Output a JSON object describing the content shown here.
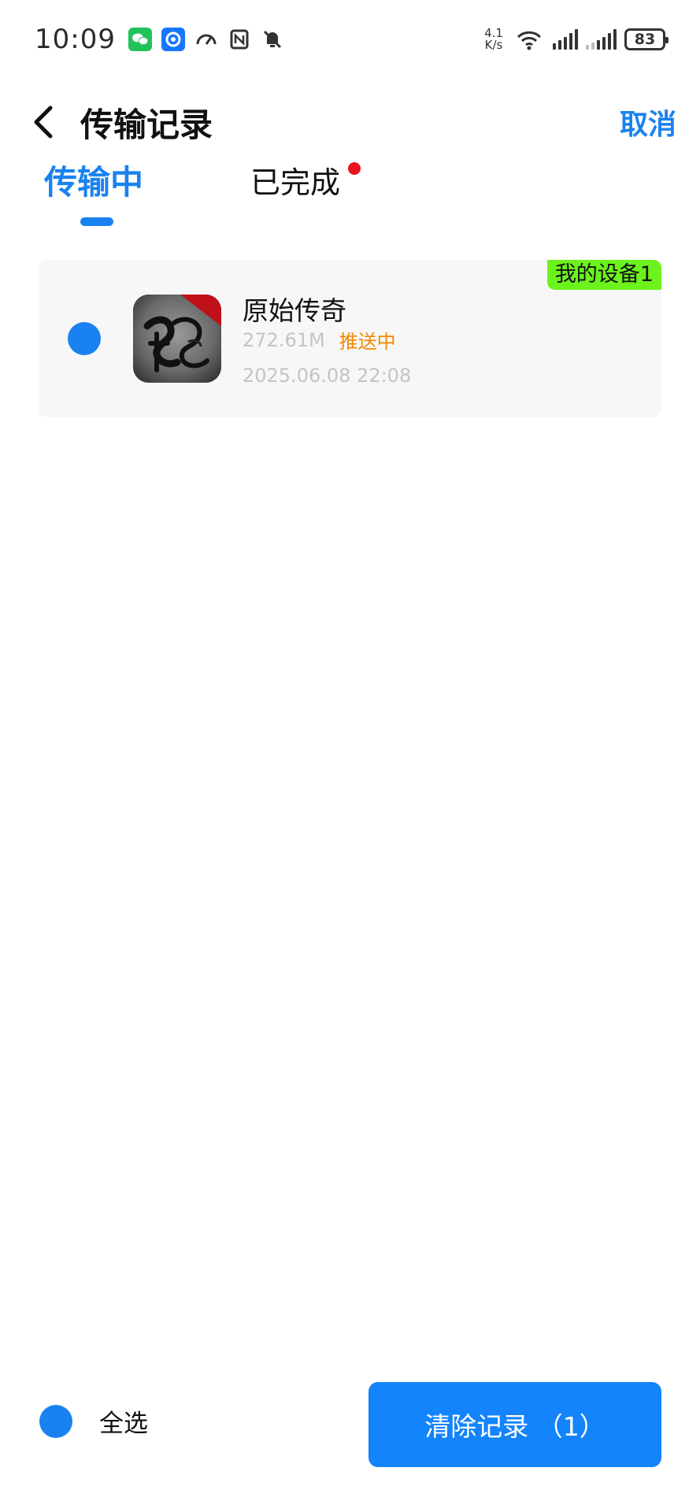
{
  "status_bar": {
    "time": "10:09",
    "net_speed_value": "4.1",
    "net_speed_unit": "K/s",
    "battery": "83",
    "icons": [
      "wechat-icon",
      "app-notification-icon",
      "speedometer-icon",
      "nfc-icon",
      "mute-bell-icon",
      "wifi-icon",
      "signal-icon",
      "signal-icon-2",
      "battery-icon"
    ]
  },
  "header": {
    "title": "传输记录",
    "cancel_label": "取消"
  },
  "tabs": {
    "active_label": "传输中",
    "done_label": "已完成"
  },
  "records": [
    {
      "device_tag": "我的设备1",
      "app_name": "原始传奇",
      "size": "272.61M",
      "status": "推送中",
      "timestamp": "2025.06.08 22:08"
    }
  ],
  "footer": {
    "select_all_label": "全选",
    "clear_button_label": "清除记录 （1）"
  },
  "colors": {
    "accent": "#1a82f0",
    "button": "#1384fb",
    "status_orange": "#f08a00",
    "device_tag_green": "#6cf21d",
    "badge_red": "#e8131c"
  }
}
